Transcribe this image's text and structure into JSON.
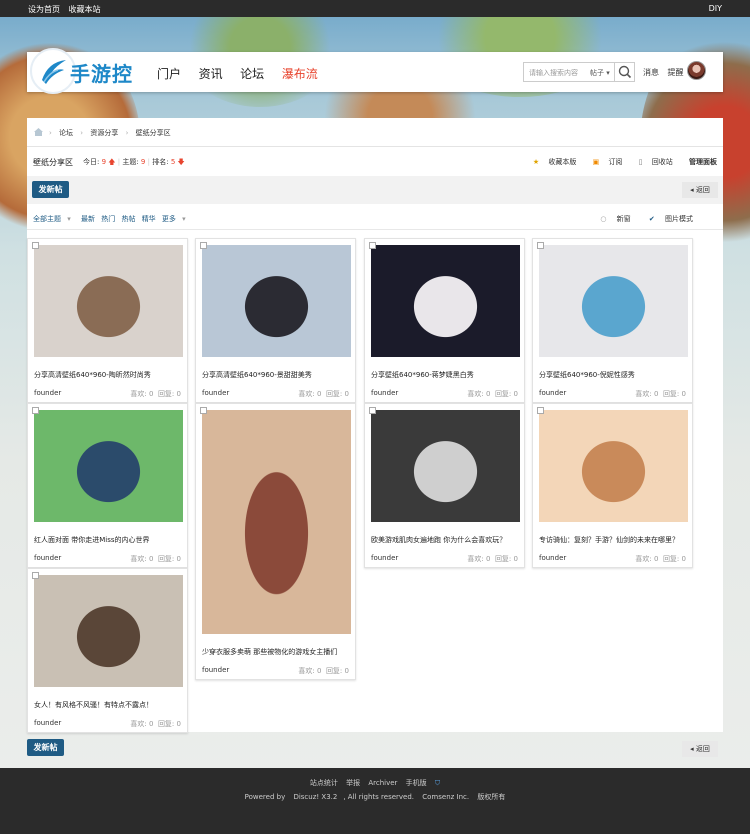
{
  "topbar": {
    "set_home": "设为首页",
    "bookmark": "收藏本站",
    "diy": "DIY"
  },
  "logo": {
    "text": "手游控"
  },
  "nav": {
    "items": [
      "门户",
      "资讯",
      "论坛",
      "瀑布流"
    ]
  },
  "search": {
    "placeholder": "请输入搜索内容",
    "scope": "帖子",
    "icon": "search-icon"
  },
  "header_right": {
    "message": "消息",
    "remind": "提醒"
  },
  "breadcrumb": {
    "items": [
      "论坛",
      "资源分享",
      "壁纸分享区"
    ]
  },
  "forum": {
    "title": "壁纸分享区",
    "today_label": "今日:",
    "today_value": "9",
    "topics_label": "主题:",
    "topics_value": "9",
    "rank_label": "排名:",
    "rank_value": "5",
    "favorite": "收藏本版",
    "subscribe": "订阅",
    "recycle": "回收站",
    "manage": "管理面板"
  },
  "actions": {
    "new_post": "发新帖",
    "back": "返回"
  },
  "filters": {
    "all": "全部主题",
    "latest": "最新",
    "hot": "热门",
    "hot_posts": "热帖",
    "digest": "精华",
    "more": "更多",
    "new_window": "新窗",
    "image_mode": "图片模式"
  },
  "cards": [
    {
      "title": "分享高清壁纸640*960-陶昕然时尚秀",
      "author": "founder",
      "likes_label": "喜欢:",
      "likes": "0",
      "replies_label": "回复:",
      "replies": "0",
      "photo_colors": [
        "#d9d2cc",
        "#8a6c55"
      ]
    },
    {
      "title": "分享高清壁纸640*960-景甜甜美秀",
      "author": "founder",
      "likes_label": "喜欢:",
      "likes": "0",
      "replies_label": "回复:",
      "replies": "0",
      "photo_colors": [
        "#b9c7d6",
        "#2b2b33"
      ]
    },
    {
      "title": "分享壁纸640*960-蒋梦婕黑白秀",
      "author": "founder",
      "likes_label": "喜欢:",
      "likes": "0",
      "replies_label": "回复:",
      "replies": "0",
      "photo_colors": [
        "#1b1b2a",
        "#e9e6ea"
      ]
    },
    {
      "title": "分享壁纸640*960-倪妮性感秀",
      "author": "founder",
      "likes_label": "喜欢:",
      "likes": "0",
      "replies_label": "回复:",
      "replies": "0",
      "photo_colors": [
        "#e7e7ea",
        "#5aa6cf"
      ]
    },
    {
      "title": "红人面对面 带你走进Miss的内心世界",
      "author": "founder",
      "likes_label": "喜欢:",
      "likes": "0",
      "replies_label": "回复:",
      "replies": "0",
      "photo_colors": [
        "#6db86a",
        "#2b4b6b"
      ]
    },
    {
      "title": "少穿衣服多卖萌 那些被物化的游戏女主播们",
      "author": "founder",
      "likes_label": "喜欢:",
      "likes": "0",
      "replies_label": "回复:",
      "replies": "0",
      "photo_colors": [
        "#d8b79a",
        "#8b4a3a"
      ]
    },
    {
      "title": "欧美游戏肌肉女遍地跑 你为什么会喜欢玩？",
      "author": "founder",
      "likes_label": "喜欢:",
      "likes": "0",
      "replies_label": "回复:",
      "replies": "0",
      "photo_colors": [
        "#3a3a3a",
        "#cfcfcf"
      ]
    },
    {
      "title": "专访骑仙：复刻？手游？仙剑的未来在哪里？",
      "author": "founder",
      "likes_label": "喜欢:",
      "likes": "0",
      "replies_label": "回复:",
      "replies": "0",
      "photo_colors": [
        "#f3d6b8",
        "#c98a5a"
      ]
    },
    {
      "title": "女人！有风格不风骚！有特点不露点！",
      "author": "founder",
      "likes_label": "喜欢:",
      "likes": "0",
      "replies_label": "回复:",
      "replies": "0",
      "photo_colors": [
        "#c9c0b4",
        "#5a4638"
      ]
    }
  ],
  "footer": {
    "links": [
      "站点统计",
      "举报",
      "Archiver",
      "手机版"
    ],
    "powered_by": "Powered by",
    "product": "Discuz! X3.2",
    "rights": ", All rights reserved.",
    "company": "Comsenz Inc.",
    "copyright": "版权所有"
  },
  "colors": {
    "accent": "#1f5b84",
    "hot": "#e8452f",
    "logo_blue": "#1e88c8",
    "topbar": "#2b2b2b"
  }
}
